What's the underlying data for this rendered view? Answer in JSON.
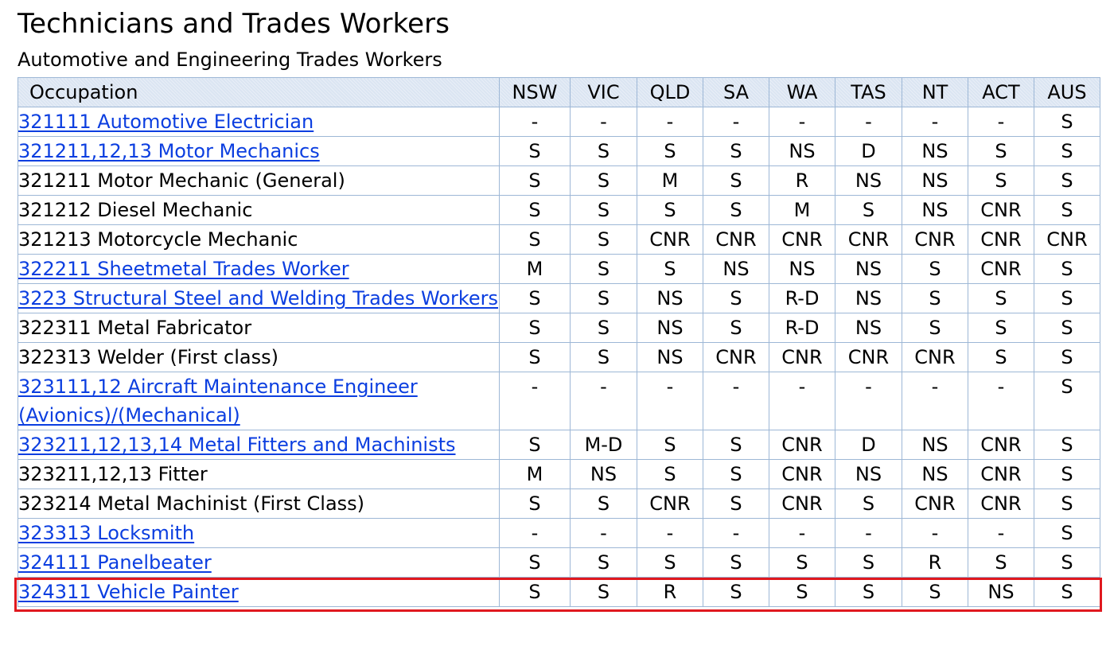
{
  "title": "Technicians and Trades Workers",
  "subtitle": "Automotive and Engineering Trades Workers",
  "table": {
    "header": {
      "occupation": "Occupation",
      "states": [
        "NSW",
        "VIC",
        "QLD",
        "SA",
        "WA",
        "TAS",
        "NT",
        "ACT",
        "AUS"
      ]
    },
    "rows": [
      {
        "occupation": "321111 Automotive Electrician",
        "link": true,
        "values": [
          "-",
          "-",
          "-",
          "-",
          "-",
          "-",
          "-",
          "-",
          "S"
        ]
      },
      {
        "occupation": "321211,12,13 Motor Mechanics",
        "link": true,
        "values": [
          "S",
          "S",
          "S",
          "S",
          "NS",
          "D",
          "NS",
          "S",
          "S"
        ]
      },
      {
        "occupation": "321211 Motor Mechanic (General)",
        "link": false,
        "values": [
          "S",
          "S",
          "M",
          "S",
          "R",
          "NS",
          "NS",
          "S",
          "S"
        ]
      },
      {
        "occupation": "321212 Diesel Mechanic",
        "link": false,
        "values": [
          "S",
          "S",
          "S",
          "S",
          "M",
          "S",
          "NS",
          "CNR",
          "S"
        ]
      },
      {
        "occupation": "321213 Motorcycle Mechanic",
        "link": false,
        "values": [
          "S",
          "S",
          "CNR",
          "CNR",
          "CNR",
          "CNR",
          "CNR",
          "CNR",
          "CNR"
        ]
      },
      {
        "occupation": "322211 Sheetmetal Trades Worker",
        "link": true,
        "values": [
          "M",
          "S",
          "S",
          "NS",
          "NS",
          "NS",
          "S",
          "CNR",
          "S"
        ]
      },
      {
        "occupation": "3223 Structural Steel and Welding Trades Workers",
        "link": true,
        "values": [
          "S",
          "S",
          "NS",
          "S",
          "R-D",
          "NS",
          "S",
          "S",
          "S"
        ]
      },
      {
        "occupation": "322311 Metal Fabricator",
        "link": false,
        "values": [
          "S",
          "S",
          "NS",
          "S",
          "R-D",
          "NS",
          "S",
          "S",
          "S"
        ]
      },
      {
        "occupation": "322313 Welder (First class)",
        "link": false,
        "values": [
          "S",
          "S",
          "NS",
          "CNR",
          "CNR",
          "CNR",
          "CNR",
          "S",
          "S"
        ]
      },
      {
        "occupation": "323111,12 Aircraft Maintenance Engineer (Avionics)/(Mechanical)",
        "link": true,
        "values": [
          "-",
          "-",
          "-",
          "-",
          "-",
          "-",
          "-",
          "-",
          "S"
        ]
      },
      {
        "occupation": "323211,12,13,14 Metal Fitters and Machinists",
        "link": true,
        "values": [
          "S",
          "M-D",
          "S",
          "S",
          "CNR",
          "D",
          "NS",
          "CNR",
          "S"
        ]
      },
      {
        "occupation": "323211,12,13 Fitter",
        "link": false,
        "values": [
          "M",
          "NS",
          "S",
          "S",
          "CNR",
          "NS",
          "NS",
          "CNR",
          "S"
        ]
      },
      {
        "occupation": "323214 Metal Machinist (First Class)",
        "link": false,
        "values": [
          "S",
          "S",
          "CNR",
          "S",
          "CNR",
          "S",
          "CNR",
          "CNR",
          "S"
        ]
      },
      {
        "occupation": "323313 Locksmith",
        "link": true,
        "values": [
          "-",
          "-",
          "-",
          "-",
          "-",
          "-",
          "-",
          "-",
          "S"
        ]
      },
      {
        "occupation": "324111 Panelbeater",
        "link": true,
        "highlighted": true,
        "values": [
          "S",
          "S",
          "S",
          "S",
          "S",
          "S",
          "R",
          "S",
          "S"
        ]
      },
      {
        "occupation": "324311 Vehicle Painter",
        "link": true,
        "values": [
          "S",
          "S",
          "R",
          "S",
          "S",
          "S",
          "S",
          "NS",
          "S"
        ]
      }
    ]
  },
  "colors": {
    "link": "#0b3ee0",
    "header_bg": "#dbe5f2",
    "border": "#9db7d6",
    "highlight": "#e0191f"
  }
}
